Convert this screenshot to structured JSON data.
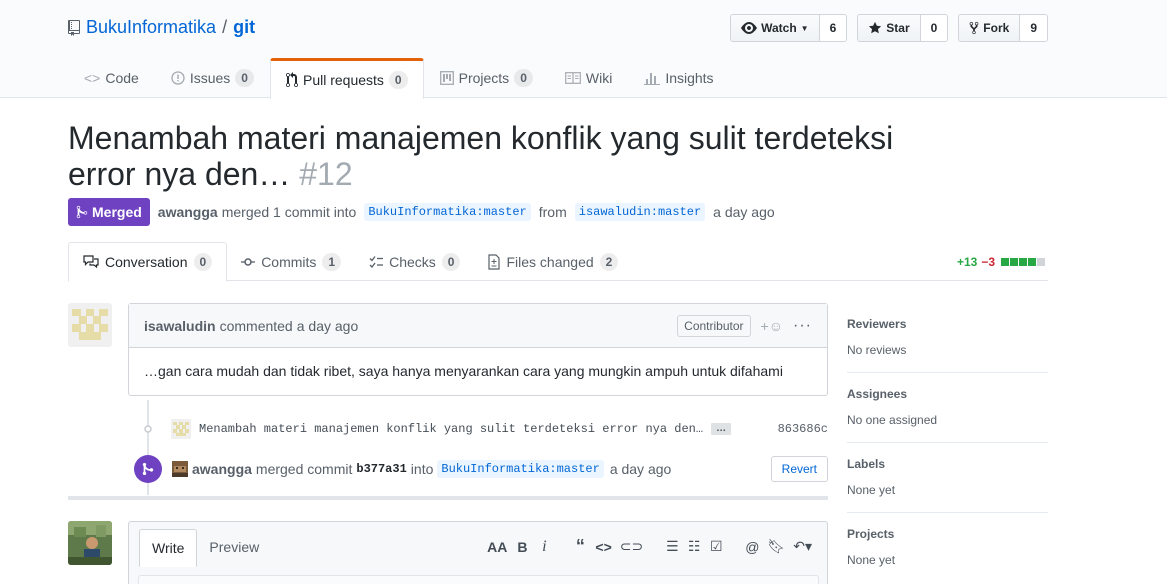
{
  "repo": {
    "owner": "BukuInformatika",
    "separator": "/",
    "name": "git"
  },
  "actions": {
    "watch_label": "Watch",
    "watch_count": "6",
    "star_label": "Star",
    "star_count": "0",
    "fork_label": "Fork",
    "fork_count": "9"
  },
  "reponav": [
    {
      "label": "Code",
      "count": ""
    },
    {
      "label": "Issues",
      "count": "0"
    },
    {
      "label": "Pull requests",
      "count": "0"
    },
    {
      "label": "Projects",
      "count": "0"
    },
    {
      "label": "Wiki",
      "count": ""
    },
    {
      "label": "Insights",
      "count": ""
    }
  ],
  "pr": {
    "title": "Menambah materi manajemen konflik yang sulit terdeteksi error nya den…",
    "number": "#12",
    "state": "Merged",
    "author": "awangga",
    "merged_text": "merged 1 commit into",
    "base_branch": "BukuInformatika:master",
    "from_text": "from",
    "head_branch": "isawaludin:master",
    "time": "a day ago"
  },
  "tabs": [
    {
      "label": "Conversation",
      "count": "0"
    },
    {
      "label": "Commits",
      "count": "1"
    },
    {
      "label": "Checks",
      "count": "0"
    },
    {
      "label": "Files changed",
      "count": "2"
    }
  ],
  "diffstat": {
    "added": "+13",
    "removed": "−3"
  },
  "comment": {
    "author": "isawaludin",
    "action": "commented",
    "time": "a day ago",
    "role": "Contributor",
    "body": "…gan cara mudah dan tidak ribet, saya hanya menyarankan cara yang mungkin ampuh untuk difahami"
  },
  "commit": {
    "message": "Menambah materi manajemen konflik yang sulit terdeteksi error nya den…",
    "ellipsis": "…",
    "sha": "863686c"
  },
  "merge_event": {
    "author": "awangga",
    "text": "merged commit",
    "sha": "b377a31",
    "into": "into",
    "branch": "BukuInformatika:master",
    "time": "a day ago",
    "revert_label": "Revert"
  },
  "new_comment": {
    "write_tab": "Write",
    "preview_tab": "Preview"
  },
  "sidebar": {
    "reviewers_heading": "Reviewers",
    "reviewers_value": "No reviews",
    "assignees_heading": "Assignees",
    "assignees_value": "No one assigned",
    "labels_heading": "Labels",
    "labels_value": "None yet",
    "projects_heading": "Projects",
    "projects_value": "None yet"
  },
  "colors": {
    "link": "#0366d6",
    "merged": "#6f42c1",
    "nav_active": "#e36209",
    "added": "#28a745",
    "removed": "#cb2431"
  }
}
